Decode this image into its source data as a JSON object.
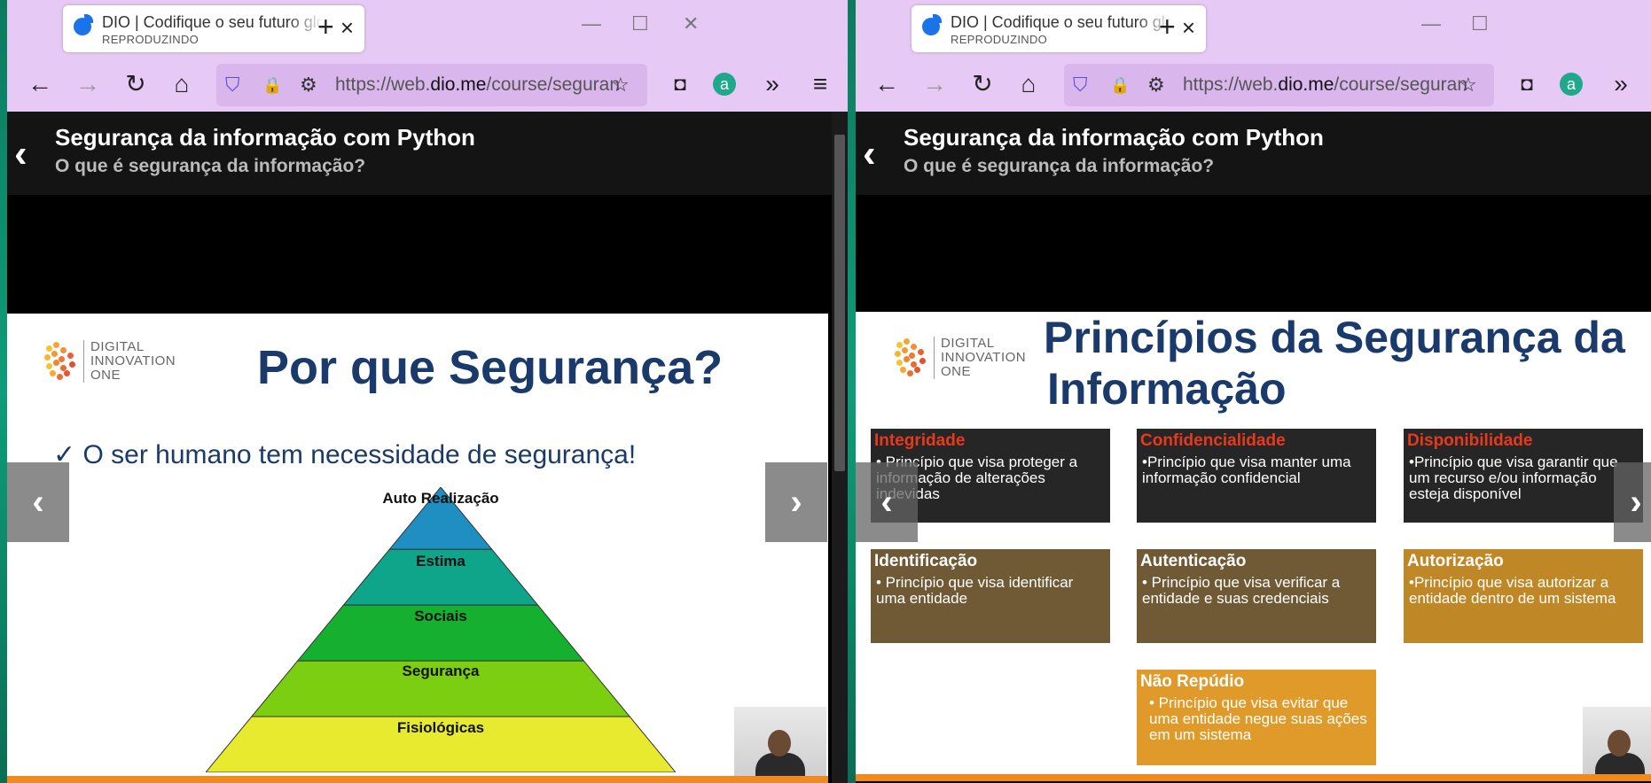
{
  "browser": {
    "tab_title": "DIO | Codifique o seu futuro global",
    "tab_status": "REPRODUZINDO",
    "url_prefix": "https://web.",
    "url_domain": "dio.me",
    "url_suffix": "/course/seguranca-da-informacao-com-python"
  },
  "course": {
    "title": "Segurança da informação com Python",
    "lesson": "O que é segurança da informação?"
  },
  "logo": {
    "line1": "DIGITAL",
    "line2": "INNOVATION",
    "line3": "ONE"
  },
  "left_slide": {
    "title": "Por que Segurança?",
    "check": "✓",
    "bullet": "O ser humano tem necessidade de segurança!",
    "pyramid": [
      "Auto Realização",
      "Estima",
      "Sociais",
      "Segurança",
      "Fisiológicas"
    ],
    "pyramid_colors": [
      "#1f8fc2",
      "#0fa58a",
      "#16b031",
      "#7ccf10",
      "#e7ea2e"
    ]
  },
  "right_slide": {
    "title_line1": "Princípios da Segurança da",
    "title_line2": "Informação",
    "principles": [
      {
        "title": "Integridade",
        "text": "• Princípio que visa proteger a informação de alterações indevidas"
      },
      {
        "title": "Confidencialidade",
        "text": "•Princípio que visa manter uma informação confidencial"
      },
      {
        "title": "Disponibilidade",
        "text": "•Princípio que visa garantir que um recurso e/ou informação esteja disponível"
      },
      {
        "title": "Identificação",
        "text": "• Princípio que visa identificar uma entidade"
      },
      {
        "title": "Autenticação",
        "text": "• Princípio que visa verificar a entidade e suas credenciais"
      },
      {
        "title": "Autorização",
        "text": "•Princípio que visa autorizar a entidade dentro de um sistema"
      },
      {
        "title": "Não Repúdio",
        "text": "• Princípio que visa evitar que uma entidade negue suas ações em um sistema"
      }
    ]
  },
  "icons": {
    "tab_close": "×",
    "new_tab": "+",
    "minimize": "—",
    "maximize": "☐",
    "close_window": "✕",
    "back": "←",
    "forward": "→",
    "reload": "↻",
    "home": "⌂",
    "shield": "⛉",
    "lock": "🔒",
    "permissions": "⚙",
    "star": "☆",
    "pocket": "◘",
    "extension": "a",
    "overflow": "»",
    "menu": "≡",
    "slide_prev": "‹",
    "slide_next": "›",
    "course_back": "‹"
  }
}
